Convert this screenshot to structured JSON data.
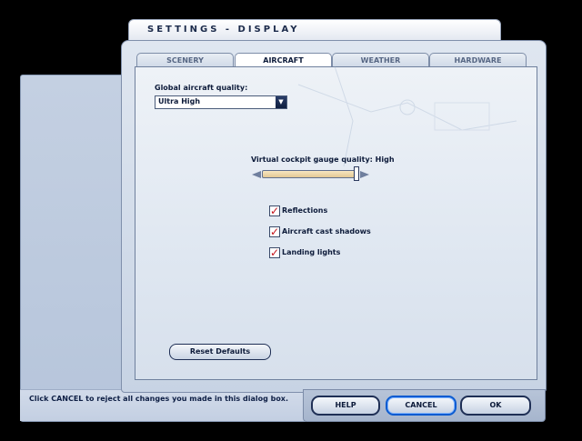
{
  "window": {
    "title": "SETTINGS - DISPLAY"
  },
  "tabs": [
    {
      "label": "SCENERY",
      "active": false
    },
    {
      "label": "AIRCRAFT",
      "active": true
    },
    {
      "label": "WEATHER",
      "active": false
    },
    {
      "label": "HARDWARE",
      "active": false
    }
  ],
  "aircraft": {
    "global_quality_label": "Global aircraft quality:",
    "global_quality_value": "Ultra High",
    "gauge_label": "Virtual cockpit gauge quality: High",
    "gauge_level": 1.0,
    "checkboxes": [
      {
        "label": "Reflections",
        "checked": true
      },
      {
        "label": "Aircraft cast shadows",
        "checked": true
      },
      {
        "label": "Landing lights",
        "checked": true
      }
    ],
    "reset_label": "Reset Defaults"
  },
  "footer": {
    "info_text": "Click CANCEL to reject all changes you made in this dialog box.",
    "help_label": "HELP",
    "cancel_label": "CANCEL",
    "ok_label": "OK"
  },
  "icons": {
    "dropdown_arrow": "▼",
    "checkmark": "✓"
  }
}
